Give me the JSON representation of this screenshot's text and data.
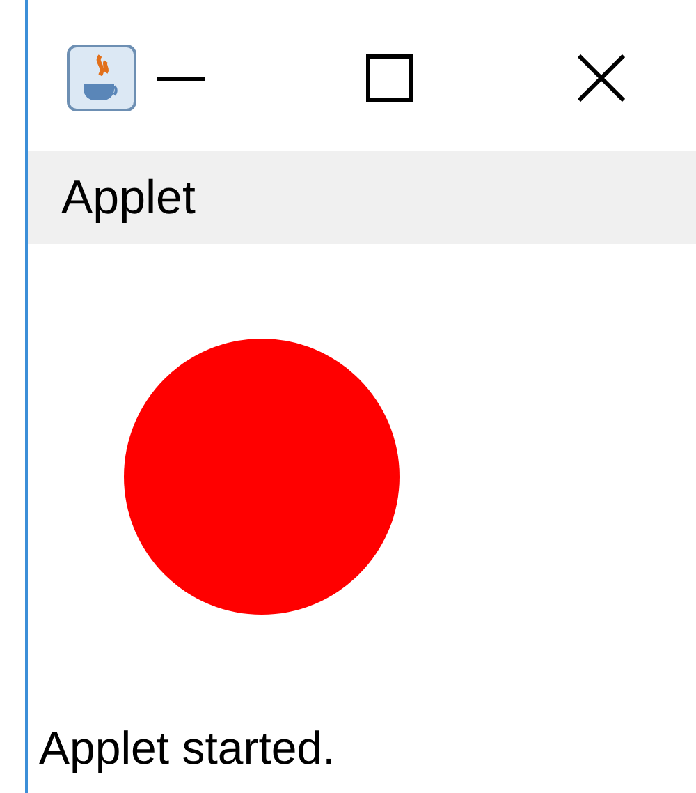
{
  "window": {
    "controls": [
      {
        "kind": "minimize"
      },
      {
        "kind": "maximize"
      },
      {
        "kind": "close"
      }
    ]
  },
  "menu": [
    {
      "label": "Applet"
    }
  ],
  "canvas": {
    "shapes": [
      {
        "kind": "circle"
      }
    ]
  },
  "status_bar": "Applet started."
}
